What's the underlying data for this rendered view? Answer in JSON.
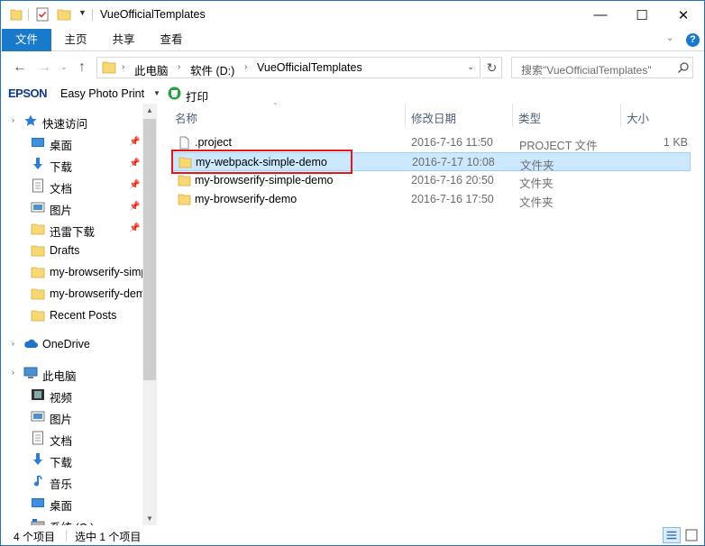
{
  "window": {
    "title": "VueOfficialTemplates",
    "controls": {
      "minimize": "—",
      "maximize": "☐",
      "close": "✕"
    }
  },
  "ribbon": {
    "tabs": [
      "文件",
      "主页",
      "共享",
      "查看"
    ],
    "active_tab": "文件",
    "accent": "#1979ca"
  },
  "address": {
    "crumbs": [
      "此电脑",
      "软件 (D:)",
      "VueOfficialTemplates"
    ],
    "search_placeholder": "搜索\"VueOfficialTemplates\""
  },
  "toolbar": {
    "brand": "EPSON",
    "app": "Easy Photo Print",
    "print_label": "打印"
  },
  "nav_pane": {
    "quick_access": "快速访问",
    "quick_items": [
      {
        "label": "桌面",
        "icon": "desktop-icon",
        "pinned": true
      },
      {
        "label": "下载",
        "icon": "download-icon",
        "pinned": true
      },
      {
        "label": "文档",
        "icon": "document-icon",
        "pinned": true
      },
      {
        "label": "图片",
        "icon": "picture-icon",
        "pinned": true
      },
      {
        "label": "迅雷下载",
        "icon": "folder-icon",
        "pinned": true
      },
      {
        "label": "Drafts",
        "icon": "folder-icon",
        "pinned": false
      },
      {
        "label": "my-browserify-simple-demo",
        "icon": "folder-icon",
        "pinned": false
      },
      {
        "label": "my-browserify-demo",
        "icon": "folder-icon",
        "pinned": false
      },
      {
        "label": "Recent Posts",
        "icon": "folder-icon",
        "pinned": false
      }
    ],
    "onedrive": "OneDrive",
    "this_pc": "此电脑",
    "pc_items": [
      {
        "label": "视频",
        "icon": "video-icon"
      },
      {
        "label": "图片",
        "icon": "picture-icon"
      },
      {
        "label": "文档",
        "icon": "document-icon"
      },
      {
        "label": "下载",
        "icon": "download-icon"
      },
      {
        "label": "音乐",
        "icon": "music-icon"
      },
      {
        "label": "桌面",
        "icon": "desktop-icon"
      },
      {
        "label": "系统 (C:)",
        "icon": "drive-icon"
      }
    ]
  },
  "columns": {
    "name": "名称",
    "modified": "修改日期",
    "type": "类型",
    "size": "大小"
  },
  "files": [
    {
      "name": ".project",
      "modified": "2016-7-16 11:50",
      "type": "PROJECT 文件",
      "size": "1 KB",
      "icon": "file-icon",
      "selected": false
    },
    {
      "name": "my-webpack-simple-demo",
      "modified": "2016-7-17 10:08",
      "type": "文件夹",
      "size": "",
      "icon": "folder-icon",
      "selected": true
    },
    {
      "name": "my-browserify-simple-demo",
      "modified": "2016-7-16 20:50",
      "type": "文件夹",
      "size": "",
      "icon": "folder-icon",
      "selected": false
    },
    {
      "name": "my-browserify-demo",
      "modified": "2016-7-16 17:50",
      "type": "文件夹",
      "size": "",
      "icon": "folder-icon",
      "selected": false
    }
  ],
  "status": {
    "item_count": "4 个项目",
    "selected": "选中 1 个项目"
  }
}
